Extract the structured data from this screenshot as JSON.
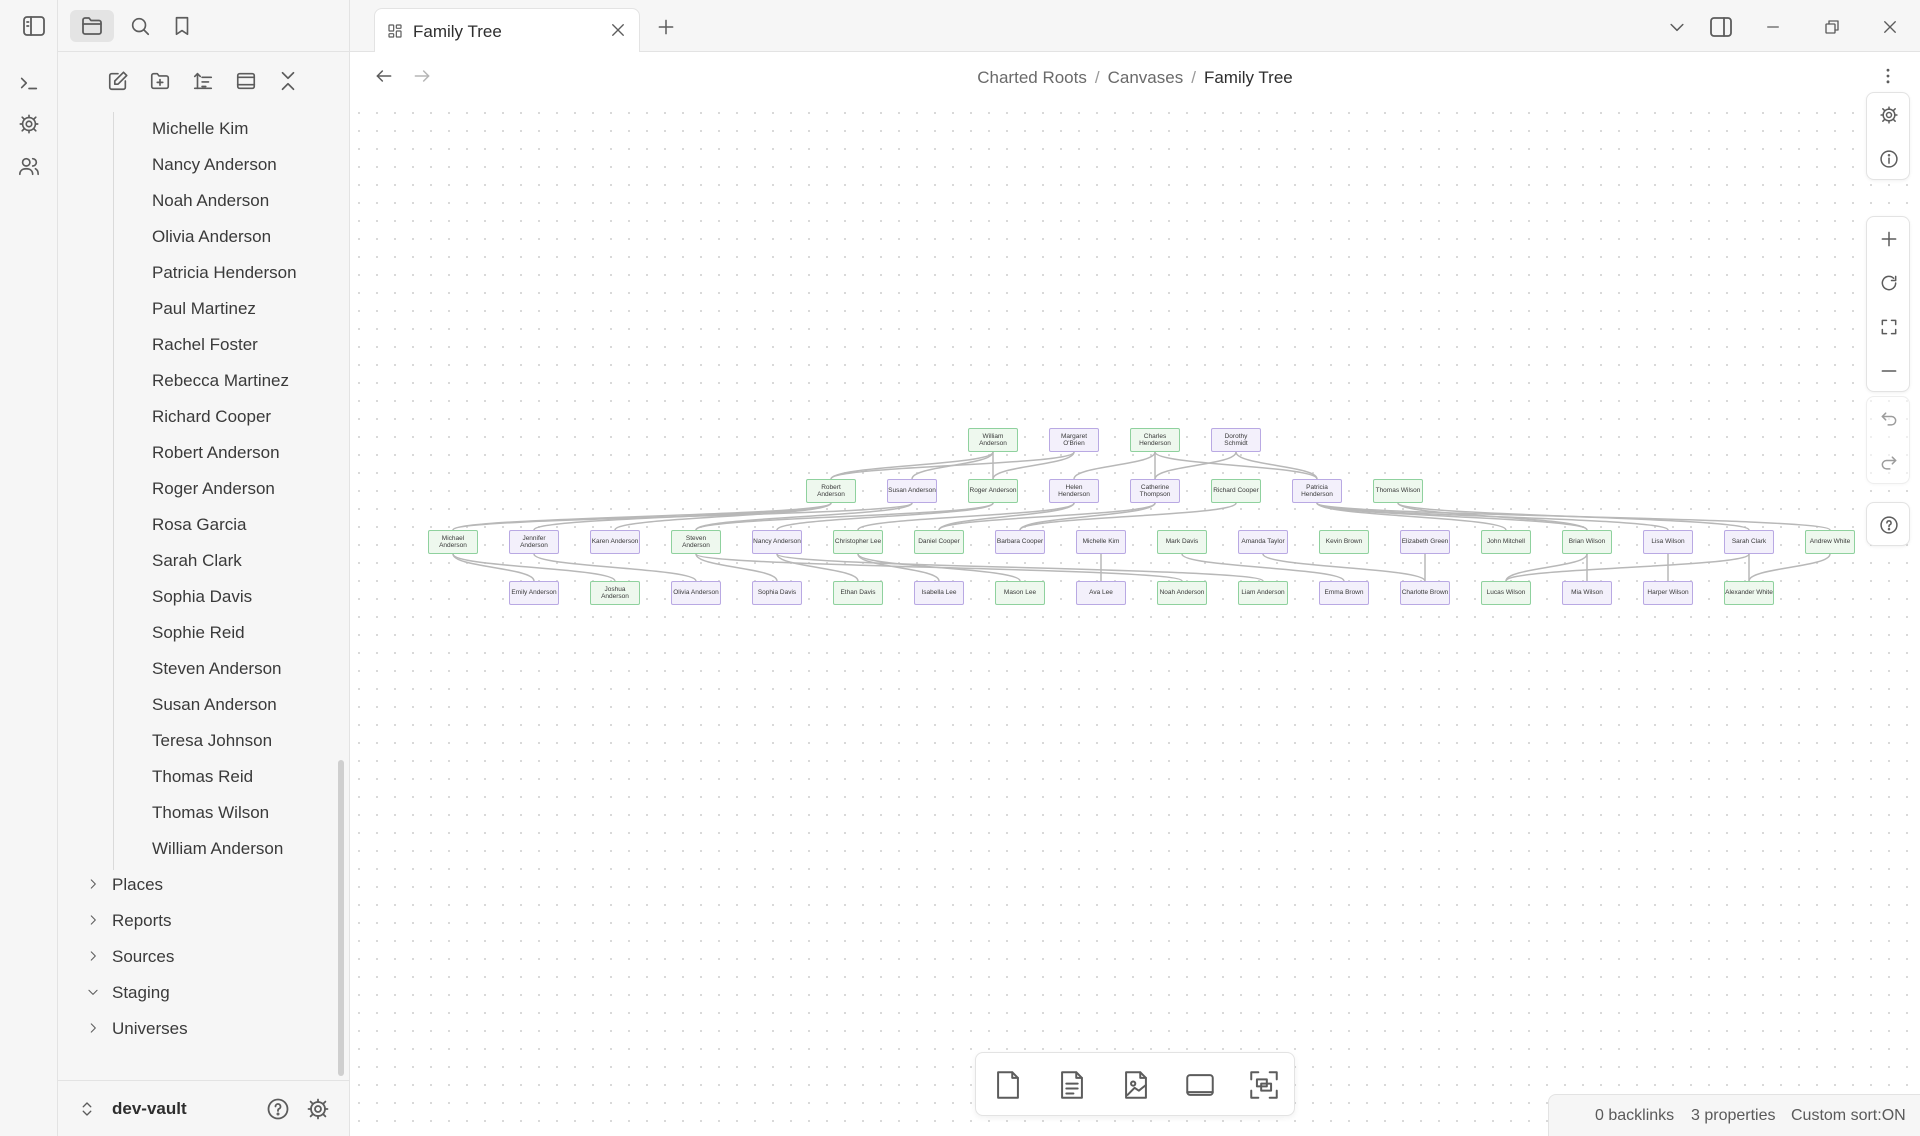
{
  "sidebar": {
    "people": [
      "Michelle Kim",
      "Nancy Anderson",
      "Noah Anderson",
      "Olivia Anderson",
      "Patricia Henderson",
      "Paul Martinez",
      "Rachel Foster",
      "Rebecca Martinez",
      "Richard Cooper",
      "Robert Anderson",
      "Roger Anderson",
      "Rosa Garcia",
      "Sarah Clark",
      "Sophia Davis",
      "Sophie Reid",
      "Steven Anderson",
      "Susan Anderson",
      "Teresa Johnson",
      "Thomas Reid",
      "Thomas Wilson",
      "William Anderson"
    ],
    "folders": [
      {
        "label": "Places",
        "expanded": false
      },
      {
        "label": "Reports",
        "expanded": false
      },
      {
        "label": "Sources",
        "expanded": false
      },
      {
        "label": "Staging",
        "expanded": true
      },
      {
        "label": "Universes",
        "expanded": false
      }
    ],
    "vault_name": "dev-vault"
  },
  "tab": {
    "title": "Family Tree"
  },
  "breadcrumb": {
    "root": "Charted Roots",
    "sep": "/",
    "middle": "Canvases",
    "current": "Family Tree"
  },
  "status": {
    "backlinks": "0 backlinks",
    "properties": "3 properties",
    "sort": "Custom sort:ON"
  },
  "colors": {
    "male_fill": "#eef8ee",
    "male_border": "#8fd19e",
    "female_fill": "#f3f0fb",
    "female_border": "#b9a9e3",
    "edge": "#b8b8b8"
  },
  "tree": {
    "gen1": [
      {
        "name": "William Anderson",
        "g": "m"
      },
      {
        "name": "Margaret O'Brien",
        "g": "f"
      },
      {
        "name": "Charles Henderson",
        "g": "m"
      },
      {
        "name": "Dorothy Schmidt",
        "g": "f"
      }
    ],
    "gen2": [
      {
        "name": "Robert Anderson",
        "g": "m"
      },
      {
        "name": "Susan Anderson",
        "g": "f"
      },
      {
        "name": "Roger Anderson",
        "g": "m"
      },
      {
        "name": "Helen Henderson",
        "g": "f"
      },
      {
        "name": "Catherine Thompson",
        "g": "f"
      },
      {
        "name": "Richard Cooper",
        "g": "m"
      },
      {
        "name": "Patricia Henderson",
        "g": "f"
      },
      {
        "name": "Thomas Wilson",
        "g": "m"
      }
    ],
    "gen3": [
      {
        "name": "Michael Anderson",
        "g": "m"
      },
      {
        "name": "Jennifer Anderson",
        "g": "f"
      },
      {
        "name": "Karen Anderson",
        "g": "f"
      },
      {
        "name": "Steven Anderson",
        "g": "m"
      },
      {
        "name": "Nancy Anderson",
        "g": "f"
      },
      {
        "name": "Christopher Lee",
        "g": "m"
      },
      {
        "name": "Daniel Cooper",
        "g": "m"
      },
      {
        "name": "Barbara Cooper",
        "g": "f"
      },
      {
        "name": "Michelle Kim",
        "g": "f"
      },
      {
        "name": "Mark Davis",
        "g": "m"
      },
      {
        "name": "Amanda Taylor",
        "g": "f"
      },
      {
        "name": "Kevin Brown",
        "g": "m"
      },
      {
        "name": "Elizabeth Green",
        "g": "f"
      },
      {
        "name": "John Mitchell",
        "g": "m"
      },
      {
        "name": "Brian Wilson",
        "g": "m"
      },
      {
        "name": "Lisa Wilson",
        "g": "f"
      },
      {
        "name": "Sarah Clark",
        "g": "f"
      },
      {
        "name": "Andrew White",
        "g": "m"
      }
    ],
    "gen4": [
      {
        "name": "Emily Anderson",
        "g": "f"
      },
      {
        "name": "Joshua Anderson",
        "g": "m"
      },
      {
        "name": "Olivia Anderson",
        "g": "f"
      },
      {
        "name": "Sophia Davis",
        "g": "f"
      },
      {
        "name": "Ethan Davis",
        "g": "m"
      },
      {
        "name": "Isabella Lee",
        "g": "f"
      },
      {
        "name": "Mason Lee",
        "g": "m"
      },
      {
        "name": "Ava Lee",
        "g": "f"
      },
      {
        "name": "Noah Anderson",
        "g": "m"
      },
      {
        "name": "Liam Anderson",
        "g": "m"
      },
      {
        "name": "Emma Brown",
        "g": "f"
      },
      {
        "name": "Charlotte Brown",
        "g": "f"
      },
      {
        "name": "Lucas Wilson",
        "g": "m"
      },
      {
        "name": "Mia Wilson",
        "g": "f"
      },
      {
        "name": "Harper Wilson",
        "g": "f"
      },
      {
        "name": "Alexander White",
        "g": "m"
      }
    ]
  }
}
